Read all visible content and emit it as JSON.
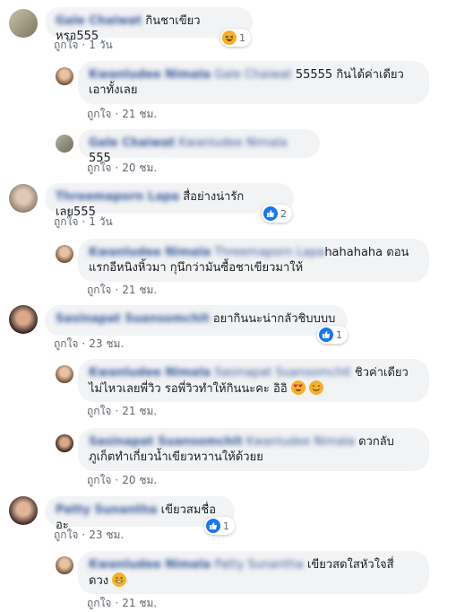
{
  "actions": {
    "like_label": "ถูกใจ",
    "separator": "·"
  },
  "comments": [
    {
      "author": "Gale Chaiwat",
      "text": "กินชาเขียวหรอ555",
      "time": "1 วัน",
      "reaction_count": "1",
      "reaction_type": "haha"
    },
    {
      "author": "Kwanludee Nimala",
      "tag": "Gale Chaiwat",
      "text_line1": "55555 กินได้ค่าเดียว",
      "text_line2": "เอาทั้งเลย",
      "time": "21 ชม."
    },
    {
      "author": "Gale Chaiwat",
      "tag": "Kwanludee Nimala",
      "text": "555",
      "time": "20 ชม."
    },
    {
      "author": "Threemaporn Lapa",
      "text": "สื่อย่างน่ารักเลย555",
      "time": "1 วัน",
      "reaction_count": "2",
      "reaction_type": "like"
    },
    {
      "author": "Kwanludee Nimala",
      "tag": "Threemaporn Lapa",
      "text_line1": "hahahaha ตอน",
      "text_line2": "แรกอีหนิงหิ้วมา กุนึกว่ามันซื้อชาเขียวมาให้",
      "time": "21 ชม."
    },
    {
      "author": "Sasinapat Suansomchit",
      "text": "อยากินนะน่ากลัวชิบบบบ",
      "time": "23 ชม.",
      "reaction_count": "1",
      "reaction_type": "like"
    },
    {
      "author": "Kwanludee Nimala",
      "tag": "Sasinapat Suansomchit",
      "text_line1": "ชิวค่าเดียว",
      "text_line2": "ไม่ไหวเลยพี่วิว รอพี่วิวทำให้กินนะคะ อิอิ",
      "time": "21 ชม."
    },
    {
      "author": "Sasinapat Suansomchit",
      "tag": "Kwanludee Nimala",
      "text_line1": "ดวกลับ",
      "text_line2": "ภูเก็ตทำเกี่ยวน้ำเขียวหวานให้ด้วยย",
      "time": "20 ชม."
    },
    {
      "author": "Patty Sunantha",
      "text": "เขียวสมชื่ออะ",
      "time": "23 ชม.",
      "reaction_count": "1",
      "reaction_type": "like"
    },
    {
      "author": "Kwanludee Nimala",
      "tag": "Patty Sunantha",
      "text_line1": "เขียวสดใสหัวใจสี่",
      "text_line2": "ดวง",
      "time": "21 ชม."
    }
  ]
}
